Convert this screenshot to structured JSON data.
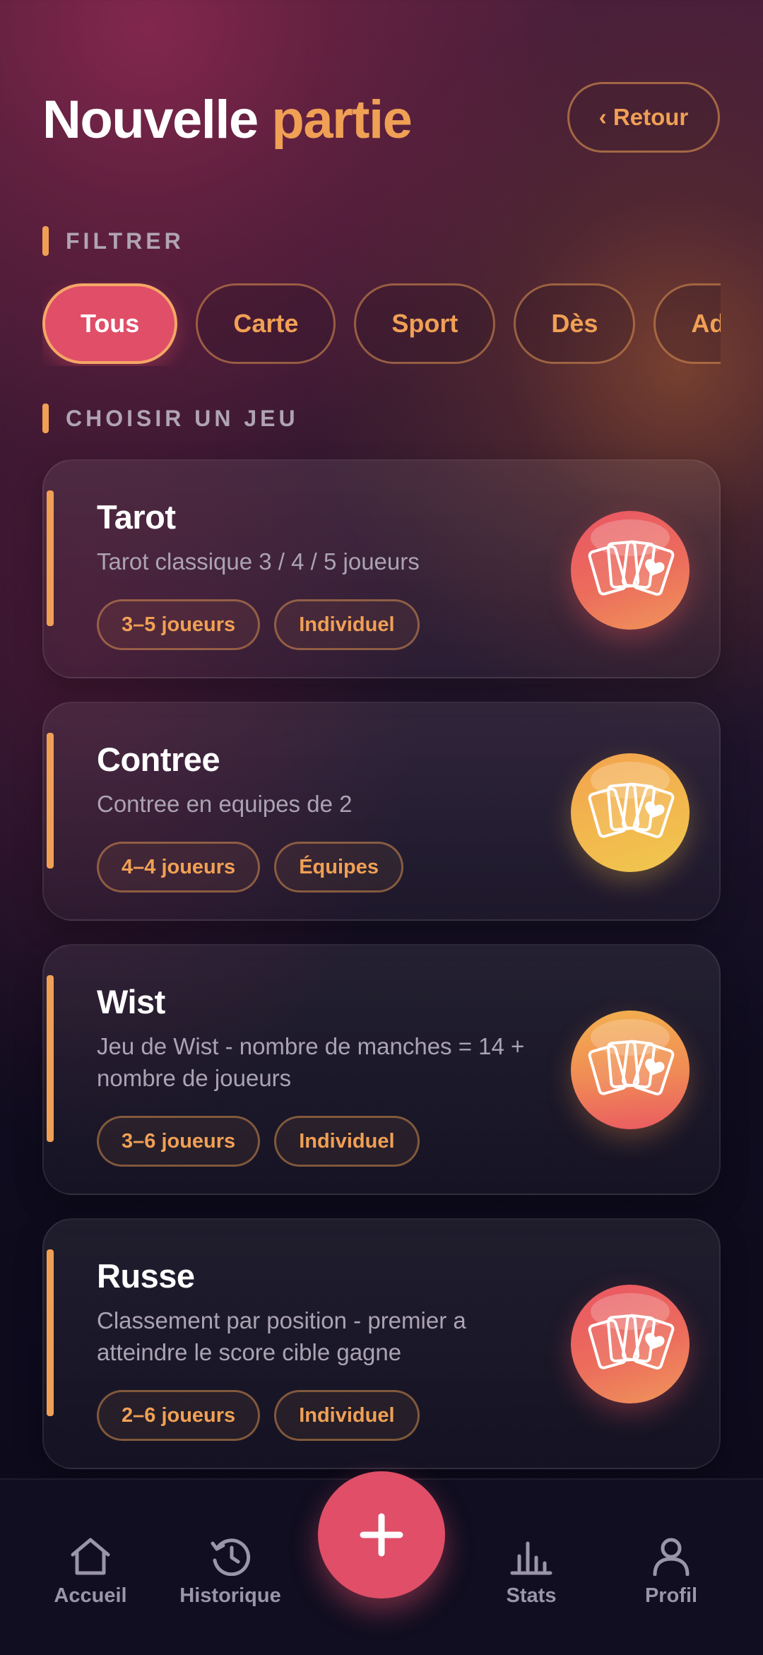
{
  "header": {
    "title_word1": "Nouvelle",
    "title_word2": "partie",
    "back_label": "‹ Retour"
  },
  "filter": {
    "section_label": "FILTRER",
    "chips": [
      {
        "label": "Tous",
        "active": true
      },
      {
        "label": "Carte",
        "active": false
      },
      {
        "label": "Sport",
        "active": false
      },
      {
        "label": "Dès",
        "active": false
      },
      {
        "label": "Adresse",
        "active": false
      }
    ]
  },
  "games": {
    "section_label": "CHOISIR UN JEU",
    "items": [
      {
        "name": "Tarot",
        "description": "Tarot classique 3 / 4 / 5 joueurs",
        "players": "3–5 joueurs",
        "mode": "Individuel",
        "icon": "playing-cards-icon",
        "icon_color": "#e95664"
      },
      {
        "name": "Contree",
        "description": "Contree en equipes de 2",
        "players": "4–4 joueurs",
        "mode": "Équipes",
        "icon": "playing-cards-icon",
        "icon_color": "#f2b84e"
      },
      {
        "name": "Wist",
        "description": "Jeu de Wist - nombre de manches = 14 + nombre de joueurs",
        "players": "3–6 joueurs",
        "mode": "Individuel",
        "icon": "playing-cards-icon",
        "icon_color": "#f08a55"
      },
      {
        "name": "Russe",
        "description": "Classement par position - premier a atteindre le score cible gagne",
        "players": "2–6 joueurs",
        "mode": "Individuel",
        "icon": "playing-cards-icon",
        "icon_color": "#ec6d5c"
      }
    ]
  },
  "nav": {
    "items": [
      {
        "label": "Accueil",
        "icon": "home-icon"
      },
      {
        "label": "Historique",
        "icon": "history-icon"
      },
      {
        "label": "Stats",
        "icon": "bar-chart-icon"
      },
      {
        "label": "Profil",
        "icon": "user-icon"
      }
    ],
    "fab_icon": "plus-icon"
  },
  "colors": {
    "accent": "#f0a055",
    "primary": "#e04e68",
    "background_dark": "#0c0a1b"
  }
}
